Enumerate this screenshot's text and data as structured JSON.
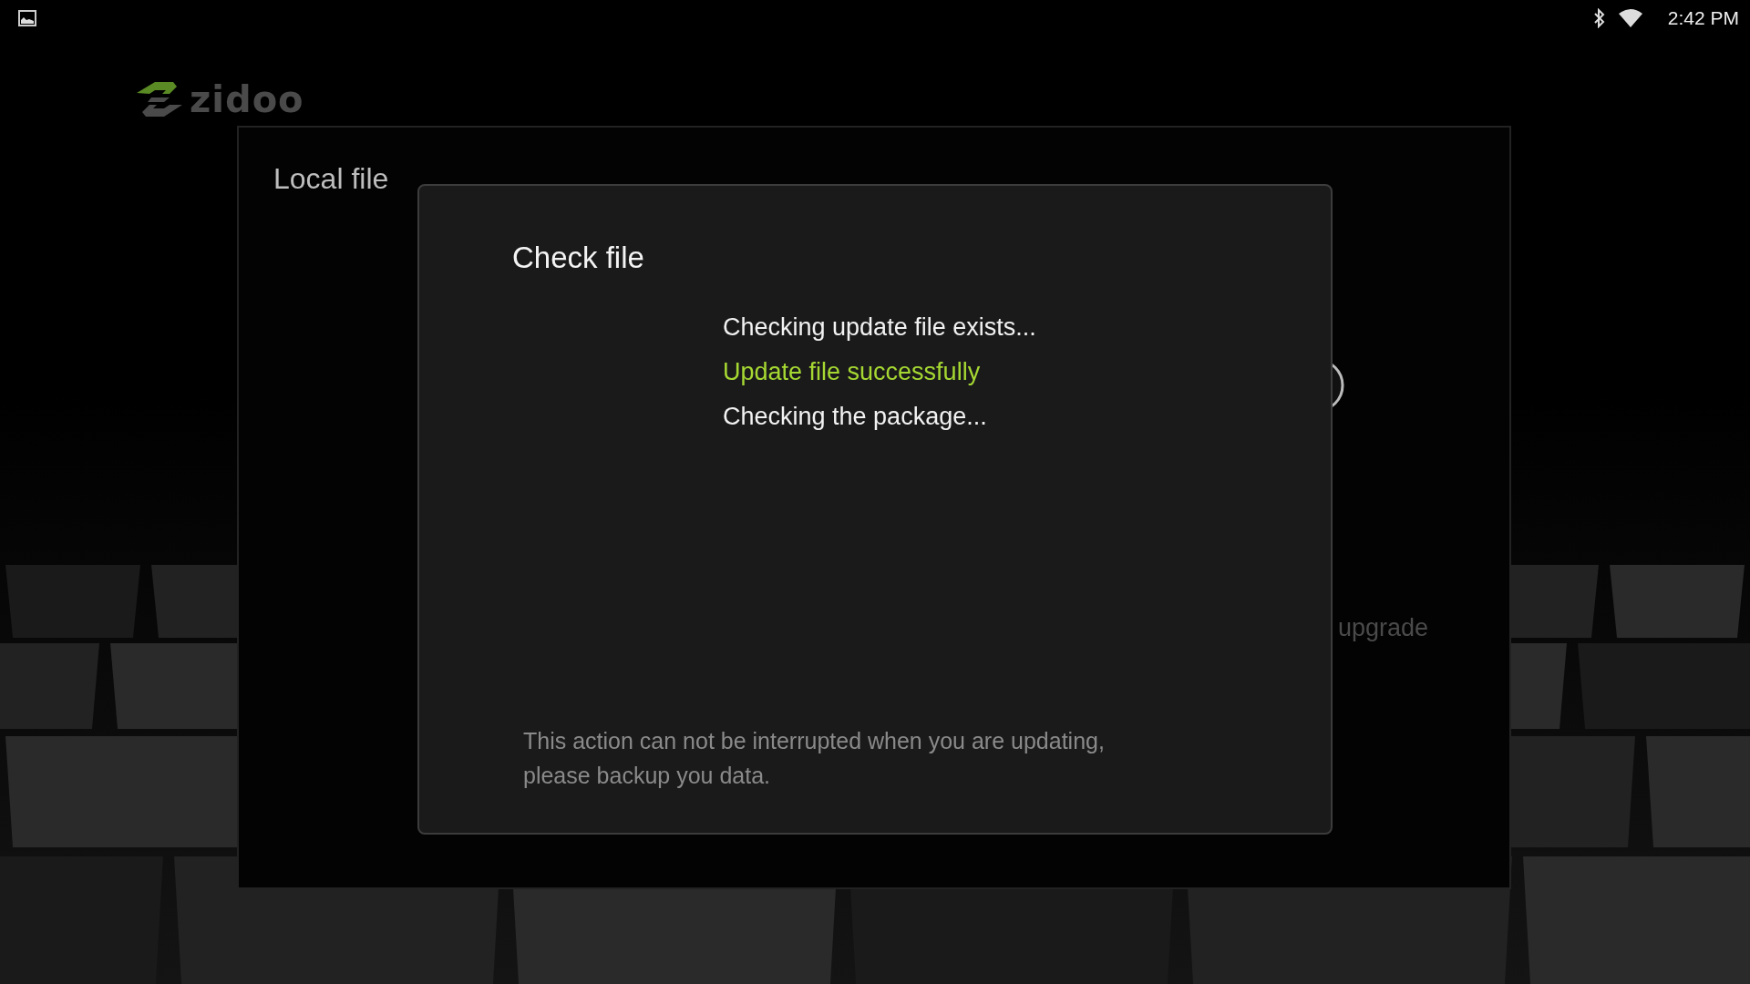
{
  "status_bar": {
    "time": "2:42 PM"
  },
  "logo": {
    "text": "zidoo"
  },
  "panel": {
    "title": "Local file",
    "hidden_label": "upgrade"
  },
  "dialog": {
    "title": "Check file",
    "messages": [
      {
        "text": "Checking update file exists...",
        "kind": "info"
      },
      {
        "text": "Update file successfully",
        "kind": "success"
      },
      {
        "text": "Checking the package...",
        "kind": "info"
      }
    ],
    "notice": "This action can not be interrupted when you are updating, please backup you data."
  }
}
